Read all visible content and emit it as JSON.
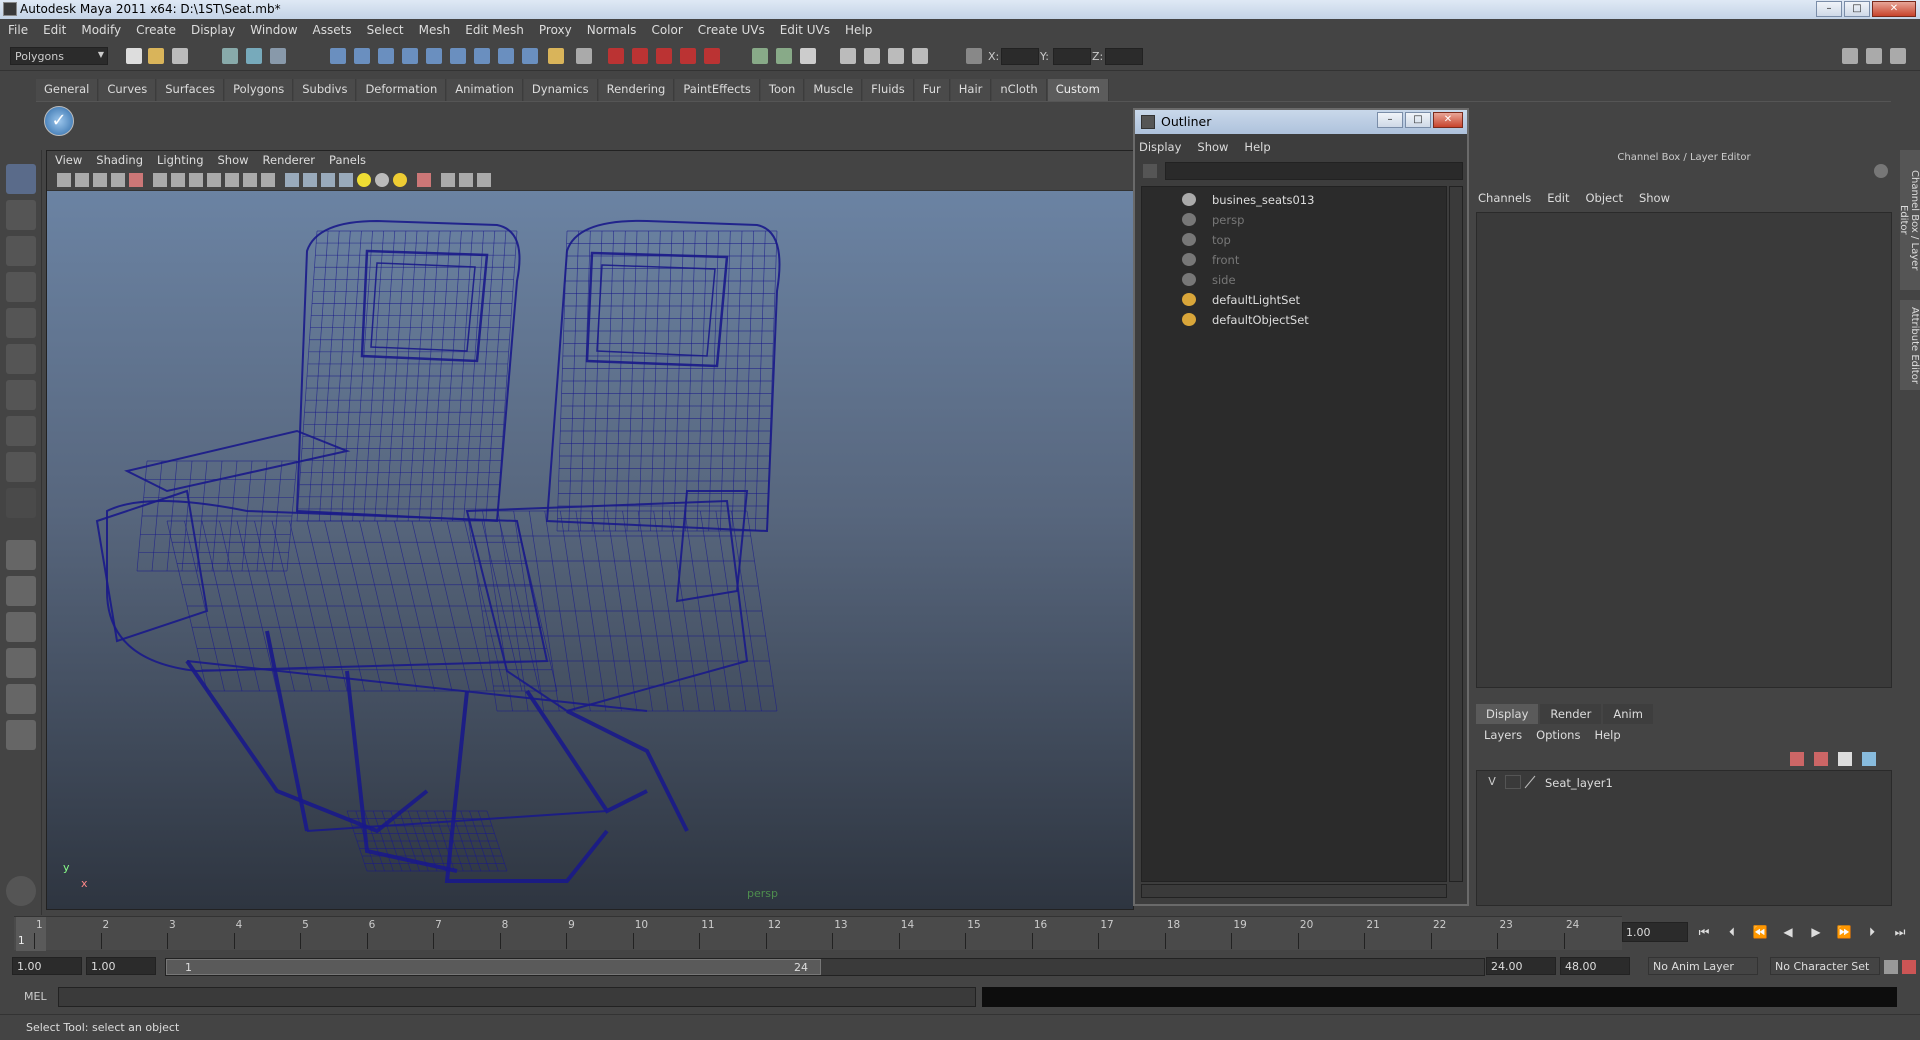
{
  "window": {
    "title": "Autodesk Maya 2011 x64: D:\\1ST\\Seat.mb*"
  },
  "menubar": [
    "File",
    "Edit",
    "Modify",
    "Create",
    "Display",
    "Window",
    "Assets",
    "Select",
    "Mesh",
    "Edit Mesh",
    "Proxy",
    "Normals",
    "Color",
    "Create UVs",
    "Edit UVs",
    "Help"
  ],
  "statusline": {
    "mode": "Polygons",
    "x_label": "X:",
    "y_label": "Y:",
    "z_label": "Z:"
  },
  "shelf": {
    "tabs": [
      "General",
      "Curves",
      "Surfaces",
      "Polygons",
      "Subdivs",
      "Deformation",
      "Animation",
      "Dynamics",
      "Rendering",
      "PaintEffects",
      "Toon",
      "Muscle",
      "Fluids",
      "Fur",
      "Hair",
      "nCloth",
      "Custom"
    ],
    "active_tab": "Custom"
  },
  "viewport": {
    "menu": [
      "View",
      "Shading",
      "Lighting",
      "Show",
      "Renderer",
      "Panels"
    ],
    "camera_label": "persp",
    "axis_y": "y",
    "axis_x": "x",
    "wire_color": "#1a1a8a"
  },
  "outliner": {
    "title": "Outliner",
    "menu": [
      "Display",
      "Show",
      "Help"
    ],
    "items": [
      {
        "label": "busines_seats013",
        "dim": false,
        "icon": "group-icon"
      },
      {
        "label": "persp",
        "dim": true,
        "icon": "camera-icon"
      },
      {
        "label": "top",
        "dim": true,
        "icon": "camera-icon"
      },
      {
        "label": "front",
        "dim": true,
        "icon": "camera-icon"
      },
      {
        "label": "side",
        "dim": true,
        "icon": "camera-icon"
      },
      {
        "label": "defaultLightSet",
        "dim": false,
        "icon": "set-icon"
      },
      {
        "label": "defaultObjectSet",
        "dim": false,
        "icon": "set-icon"
      }
    ]
  },
  "channelbox": {
    "title": "Channel Box / Layer Editor",
    "menu": [
      "Channels",
      "Edit",
      "Object",
      "Show"
    ],
    "side_tabs": [
      "Channel Box / Layer Editor",
      "Attribute Editor"
    ]
  },
  "layereditor": {
    "tabs": [
      "Display",
      "Render",
      "Anim"
    ],
    "active_tab": "Display",
    "menu": [
      "Layers",
      "Options",
      "Help"
    ],
    "layers": [
      {
        "visible": "V",
        "name": "Seat_layer1"
      }
    ]
  },
  "timeslider": {
    "ticks": [
      "1",
      "2",
      "3",
      "4",
      "5",
      "6",
      "7",
      "8",
      "9",
      "10",
      "11",
      "12",
      "13",
      "14",
      "15",
      "16",
      "17",
      "18",
      "19",
      "20",
      "21",
      "22",
      "23",
      "24"
    ],
    "current_frame": "1",
    "current_time": "1.00"
  },
  "rangeslider": {
    "start": "1.00",
    "playback_start": "1.00",
    "handle_start": "1",
    "handle_end": "24",
    "playback_end": "24.00",
    "end": "48.00",
    "anim_layer": "No Anim Layer",
    "character_set": "No Character Set"
  },
  "commandline": {
    "label": "MEL"
  },
  "helpline": {
    "text": "Select Tool: select an object"
  }
}
